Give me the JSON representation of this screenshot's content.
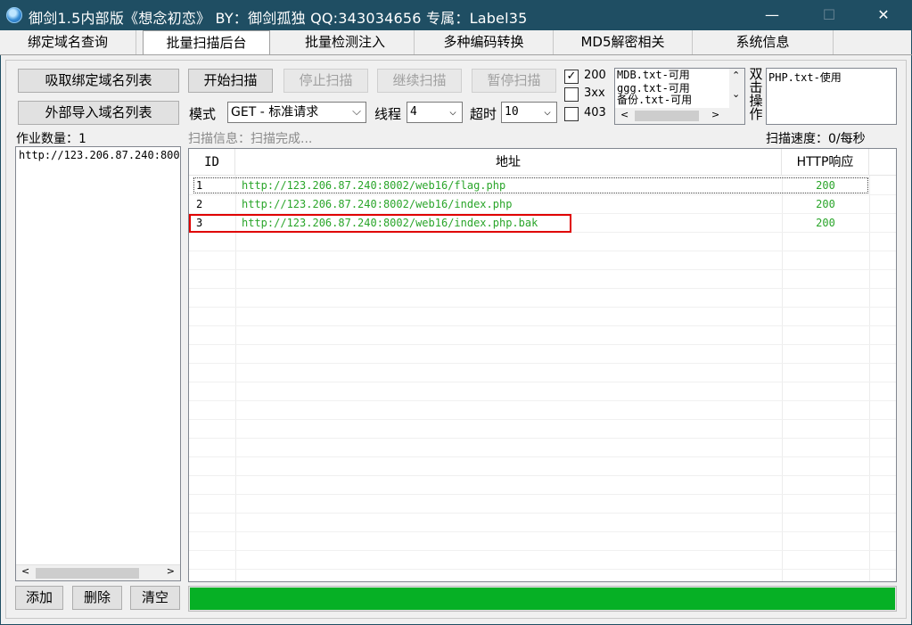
{
  "window": {
    "title": "御剑1.5内部版《想念初恋》 BY：御剑孤独 QQ:343034656    专属：Label35",
    "minimize": "—",
    "maximize": "☐",
    "close": "✕"
  },
  "tabs": [
    {
      "label": "绑定域名查询"
    },
    {
      "label": "批量扫描后台"
    },
    {
      "label": "批量检测注入"
    },
    {
      "label": "多种编码转换"
    },
    {
      "label": "MD5解密相关"
    },
    {
      "label": "系统信息"
    }
  ],
  "left": {
    "fetch_button": "吸取绑定域名列表",
    "import_button": "外部导入域名列表",
    "job_count_label": "作业数量：1",
    "jobs": [
      "http://123.206.87.240:8002"
    ],
    "add_button": "添加",
    "delete_button": "删除",
    "clear_button": "清空"
  },
  "toolbar": {
    "start": "开始扫描",
    "stop": "停止扫描",
    "resume": "继续扫描",
    "pause": "暂停扫描",
    "mode_label": "模式",
    "mode_value": "GET - 标准请求",
    "threads_label": "线程",
    "threads_value": "4",
    "timeout_label": "超时",
    "timeout_value": "10"
  },
  "filters": [
    {
      "label": "200",
      "checked": true
    },
    {
      "label": "3xx",
      "checked": false
    },
    {
      "label": "403",
      "checked": false
    }
  ],
  "dict_list": [
    "MDB.txt-可用",
    "ggg.txt-可用",
    "备份.txt-可用"
  ],
  "side_label": [
    "双",
    "击",
    "操",
    "作"
  ],
  "dict_selected": [
    "PHP.txt-使用"
  ],
  "status": {
    "scan_info": "扫描信息：扫描完成...",
    "scan_speed": "扫描速度：0/每秒"
  },
  "results": {
    "columns": {
      "id": "ID",
      "address": "地址",
      "http": "HTTP响应"
    },
    "rows": [
      {
        "id": "1",
        "address": "http://123.206.87.240:8002/web16/flag.php",
        "http": "200"
      },
      {
        "id": "2",
        "address": "http://123.206.87.240:8002/web16/index.php",
        "http": "200"
      },
      {
        "id": "3",
        "address": "http://123.206.87.240:8002/web16/index.php.bak",
        "http": "200"
      }
    ]
  },
  "progress": {
    "percent": 100
  },
  "colors": {
    "titlebar": "#1f4e63",
    "result_text": "#2aa52a",
    "progress": "#06b025",
    "highlight": "#e00000"
  }
}
